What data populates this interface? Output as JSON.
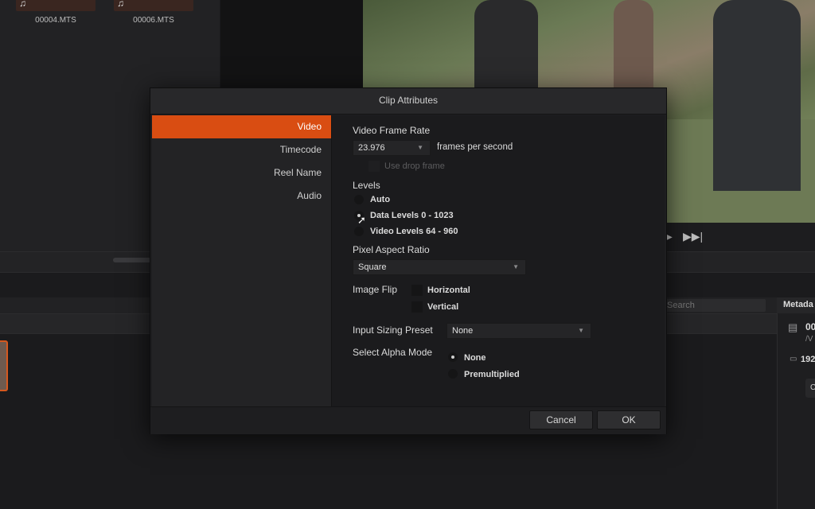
{
  "media_pool": {
    "clips": [
      {
        "name": "00004.MTS",
        "icon": "music-note-icon"
      },
      {
        "name": "00006.MTS",
        "icon": "music-note-icon"
      }
    ]
  },
  "viewer": {
    "transport": {
      "play_glyph": "▶",
      "next_glyph": "▶▶|"
    }
  },
  "toolbar": {
    "search_placeholder": "Search"
  },
  "metadata": {
    "title": "Metada",
    "line1": "00",
    "line1_sub": "/V",
    "resolution": "192",
    "extra": "C"
  },
  "dialog": {
    "title": "Clip Attributes",
    "sidebar": [
      {
        "label": "Video",
        "active": true
      },
      {
        "label": "Timecode",
        "active": false
      },
      {
        "label": "Reel Name",
        "active": false
      },
      {
        "label": "Audio",
        "active": false
      }
    ],
    "video_frame_rate": {
      "label": "Video Frame Rate",
      "value": "23.976",
      "unit": "frames per second",
      "drop_frame_label": "Use drop frame"
    },
    "levels": {
      "label": "Levels",
      "options": [
        "Auto",
        "Data Levels 0 - 1023",
        "Video Levels 64 - 960"
      ],
      "selected": "Data Levels 0 - 1023"
    },
    "pixel_aspect": {
      "label": "Pixel Aspect Ratio",
      "value": "Square"
    },
    "image_flip": {
      "label": "Image Flip",
      "horizontal": "Horizontal",
      "vertical": "Vertical"
    },
    "input_sizing": {
      "label": "Input Sizing Preset",
      "value": "None"
    },
    "alpha_mode": {
      "label": "Select Alpha Mode",
      "options": [
        "None",
        "Premultiplied"
      ],
      "selected": "None"
    },
    "buttons": {
      "cancel": "Cancel",
      "ok": "OK"
    }
  },
  "colors": {
    "accent": "#d94d12",
    "dialog_bg": "#1e1e20",
    "background": "#1b1b1d"
  }
}
